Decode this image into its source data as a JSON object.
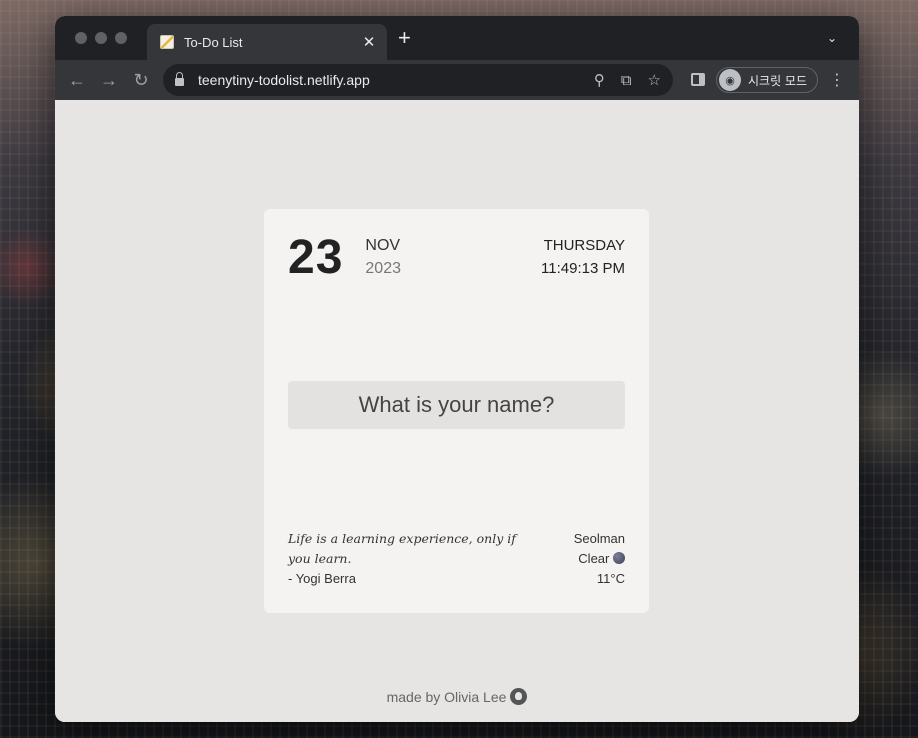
{
  "browser": {
    "tab_title": "To-Do List",
    "tab_close": "✕",
    "new_tab": "+",
    "tab_list": "⌄",
    "url": "teenytiny-todolist.netlify.app",
    "incognito_label": "시크릿 모드",
    "icons": {
      "back": "back-arrow-icon",
      "forward": "forward-arrow-icon",
      "reload": "reload-icon",
      "location": "location-pin-icon",
      "translate": "translate-icon",
      "bookmark": "star-icon",
      "menu": "kebab-menu-icon"
    }
  },
  "card": {
    "day": "23",
    "month": "NOV",
    "year": "2023",
    "weekday": "THURSDAY",
    "time": "11:49:13 PM",
    "name_placeholder": "What is your name?",
    "quote_text": "Life is a learning experience, only if you learn.",
    "quote_author": "- Yogi Berra",
    "weather_city": "Seolman",
    "weather_condition": "Clear",
    "weather_temp": "11°C"
  },
  "footer": {
    "made_by": "made by Olivia Lee"
  }
}
